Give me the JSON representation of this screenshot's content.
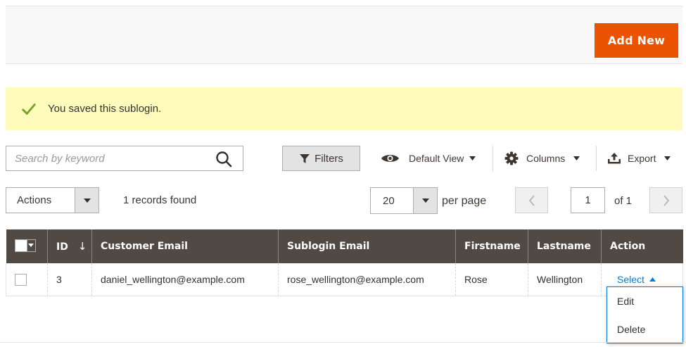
{
  "header": {
    "add_new_label": "Add New"
  },
  "message": {
    "text": "You saved this sublogin.",
    "icon": "check-icon",
    "color": "#79a22e",
    "background": "#fffbbb"
  },
  "toolbar": {
    "search_placeholder": "Search by keyword",
    "filters_label": "Filters",
    "view_label": "Default View",
    "columns_label": "Columns",
    "export_label": "Export"
  },
  "grid_controls": {
    "actions_label": "Actions",
    "records_found": "1 records found",
    "per_page_value": "20",
    "per_page_label": "per page",
    "current_page": "1",
    "page_of": "of 1"
  },
  "table": {
    "headers": {
      "id": "ID",
      "sort_indicator": "↓",
      "customer_email": "Customer Email",
      "sublogin_email": "Sublogin Email",
      "firstname": "Firstname",
      "lastname": "Lastname",
      "action": "Action"
    },
    "rows": [
      {
        "id": "3",
        "customer_email": "daniel_wellington@example.com",
        "sublogin_email": "rose_wellington@example.com",
        "firstname": "Rose",
        "lastname": "Wellington",
        "action_label": "Select"
      }
    ]
  },
  "action_menu": {
    "items": [
      {
        "label": "Edit"
      },
      {
        "label": "Delete"
      }
    ]
  },
  "colors": {
    "accent": "#eb5202",
    "header_bg": "#514943",
    "link": "#007bdb"
  }
}
